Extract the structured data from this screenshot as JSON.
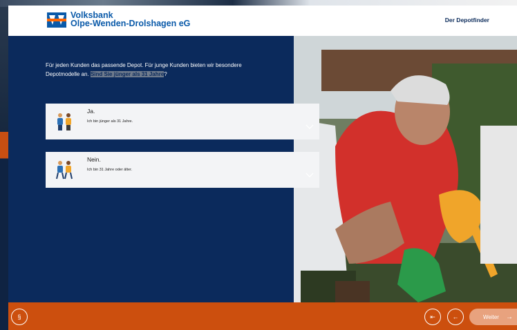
{
  "brand": {
    "line1": "Volksbank",
    "line2": "Olpe-Wenden-Drolshagen eG",
    "blue": "#0a5aa9",
    "orange": "#cc4f0e"
  },
  "header": {
    "link": "Der Depotfinder"
  },
  "intro": {
    "text": "Für jeden Kunden das passende Depot. Für junge Kunden bieten wir besondere Depotmodelle an. ",
    "question": "Sind Sie jünger als 31 Jahre",
    "suffix": "?"
  },
  "options": [
    {
      "title": "Ja.",
      "subtitle": "Ich bin jünger als 31 Jahre.",
      "icon": "young-people-icon"
    },
    {
      "title": "Nein.",
      "subtitle": "Ich bin 31 Jahre oder älter.",
      "icon": "adult-people-icon"
    }
  ],
  "footer": {
    "legal": "§",
    "first": "⇤",
    "back": "←",
    "next_label": "Weiter",
    "next_arrow": "→"
  }
}
